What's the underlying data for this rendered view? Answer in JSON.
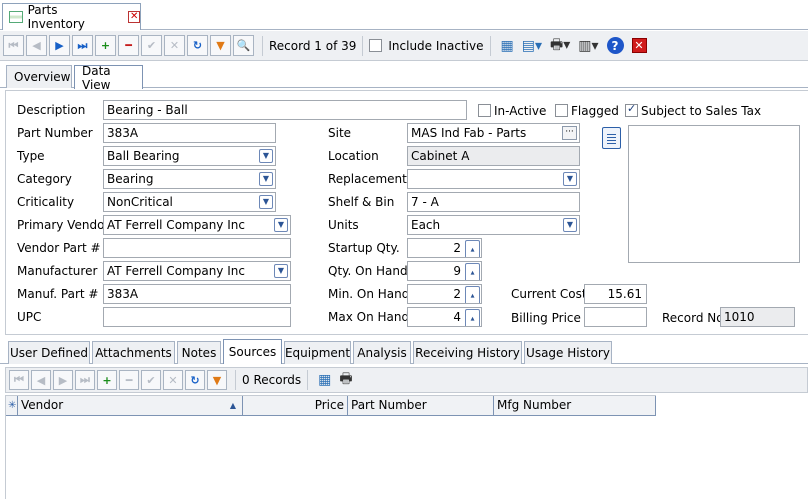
{
  "window": {
    "tab_title": "Parts Inventory"
  },
  "toolbar": {
    "record_status": "Record 1 of 39",
    "include_inactive_label": "Include Inactive",
    "include_inactive_checked": false
  },
  "view_tabs": [
    {
      "label": "Overview",
      "active": false
    },
    {
      "label": "Data View",
      "active": true
    }
  ],
  "form": {
    "description": {
      "label": "Description",
      "value": "Bearing - Ball"
    },
    "in_active": {
      "label": "In-Active",
      "checked": false
    },
    "flagged": {
      "label": "Flagged",
      "checked": false
    },
    "sales_tax": {
      "label": "Subject to Sales Tax",
      "checked": true
    },
    "part_number": {
      "label": "Part Number",
      "value": "383A"
    },
    "type": {
      "label": "Type",
      "value": "Ball Bearing"
    },
    "category": {
      "label": "Category",
      "value": "Bearing"
    },
    "criticality": {
      "label": "Criticality",
      "value": "NonCritical"
    },
    "primary_vendor": {
      "label": "Primary Vendor",
      "value": "AT Ferrell Company Inc"
    },
    "vendor_part": {
      "label": "Vendor Part #",
      "value": ""
    },
    "manufacturer": {
      "label": "Manufacturer",
      "value": "AT Ferrell Company Inc"
    },
    "manuf_part": {
      "label": "Manuf. Part #",
      "value": "383A"
    },
    "upc": {
      "label": "UPC",
      "value": ""
    },
    "site": {
      "label": "Site",
      "value": "MAS Ind Fab - Parts"
    },
    "location": {
      "label": "Location",
      "value": "Cabinet A"
    },
    "replacement": {
      "label": "Replacement",
      "value": ""
    },
    "shelf_bin": {
      "label": "Shelf & Bin",
      "value": "7 - A"
    },
    "units": {
      "label": "Units",
      "value": "Each"
    },
    "startup_qty": {
      "label": "Startup Qty.",
      "value": "2"
    },
    "qty_on_hand": {
      "label": "Qty. On Hand",
      "value": "9"
    },
    "min_on_hand": {
      "label": "Min. On Hand",
      "value": "2"
    },
    "max_on_hand": {
      "label": "Max On Hand",
      "value": "4"
    },
    "current_cost": {
      "label": "Current Cost",
      "value": "15.61"
    },
    "billing_price": {
      "label": "Billing Price",
      "value": ""
    },
    "record_no": {
      "label": "Record No",
      "value": "1010"
    }
  },
  "detail_tabs": [
    {
      "label": "User Defined",
      "active": false
    },
    {
      "label": "Attachments",
      "active": false
    },
    {
      "label": "Notes",
      "active": false
    },
    {
      "label": "Sources",
      "active": true
    },
    {
      "label": "Equipment",
      "active": false
    },
    {
      "label": "Analysis",
      "active": false
    },
    {
      "label": "Receiving History",
      "active": false
    },
    {
      "label": "Usage History",
      "active": false
    }
  ],
  "sub_toolbar": {
    "records_status": "0 Records"
  },
  "grid": {
    "columns": [
      "Vendor",
      "Price",
      "Part Number",
      "Mfg Number"
    ],
    "rows": []
  },
  "icons": {
    "first": "first-record-icon",
    "prev": "prev-record-icon",
    "next": "next-record-icon",
    "last": "last-record-icon",
    "add": "add-icon",
    "delete": "delete-icon",
    "save": "check-icon",
    "cancel": "cancel-icon",
    "refresh": "refresh-icon",
    "filter": "filter-icon",
    "search": "search-icon",
    "help": "help-icon",
    "close": "close-icon"
  },
  "colors": {
    "accent_blue": "#1760c7",
    "add_green": "#1a8d1a",
    "delete_red": "#c41b1b",
    "filter_orange": "#e07a16"
  }
}
